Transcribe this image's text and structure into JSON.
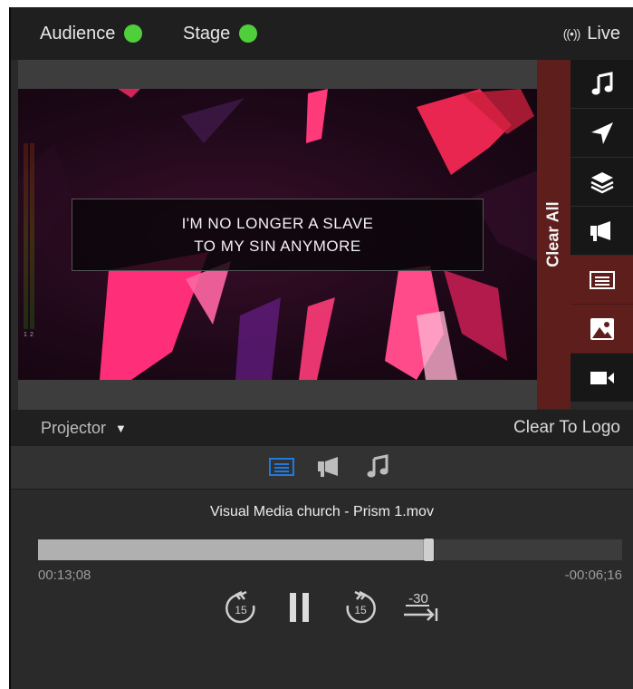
{
  "status": {
    "audience_label": "Audience",
    "stage_label": "Stage",
    "live_icon": "broadcast-icon",
    "live_label": "Live",
    "indicator_color": "#4fcf3a"
  },
  "preview": {
    "lyric_line1": "I'M NO LONGER A SLAVE",
    "lyric_line2": "TO MY SIN ANYMORE",
    "meter_labels": [
      "1",
      "2"
    ]
  },
  "clear_all_label": "Clear All",
  "side_icons": [
    "music-note-icon",
    "paper-plane-icon",
    "layers-icon",
    "megaphone-icon",
    "slide-text-icon",
    "image-icon",
    "video-camera-icon"
  ],
  "projector": {
    "label": "Projector",
    "clear_to_logo": "Clear To Logo"
  },
  "tabs": [
    "slide-text-icon",
    "megaphone-icon",
    "music-note-icon"
  ],
  "media": {
    "title": "Visual Media church - Prism 1.mov",
    "elapsed": "00:13;08",
    "remaining": "-00:06;16",
    "progress": 0.668,
    "skip_back_label": "15",
    "skip_forward_label": "15",
    "jump_label": "-30"
  },
  "colors": {
    "clear_red": "#5e1f1c",
    "accent_blue": "#1f7ae0"
  }
}
